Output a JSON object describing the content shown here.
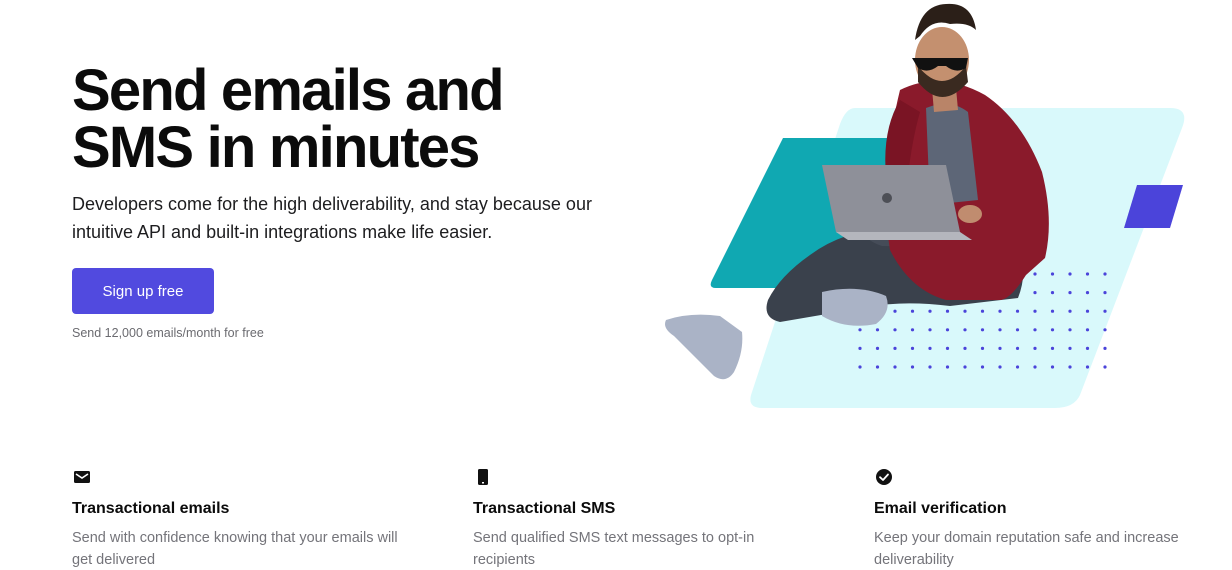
{
  "hero": {
    "title_line_1": "Send emails and",
    "title_line_2": "SMS in minutes",
    "subtitle": "Developers come for the high deliverability, and stay because our intuitive API and built-in integrations make life easier.",
    "cta_label": "Sign up free",
    "cta_note": "Send 12,000 emails/month for free"
  },
  "features": [
    {
      "icon": "envelope-icon",
      "title": "Transactional emails",
      "description": "Send with confidence knowing that your emails will get delivered"
    },
    {
      "icon": "mobile-phone-icon",
      "title": "Transactional SMS",
      "description": "Send qualified SMS text messages to opt-in recipients"
    },
    {
      "icon": "check-circle-icon",
      "title": "Email verification",
      "description": "Keep your domain reputation safe and increase deliverability"
    }
  ],
  "colors": {
    "accent": "#514adf",
    "teal": "#10a8b2",
    "light_cyan": "#d9f9fb",
    "dot_blue": "#4b44da",
    "text_dark": "#0b0b0b",
    "text_muted": "#74747a"
  }
}
